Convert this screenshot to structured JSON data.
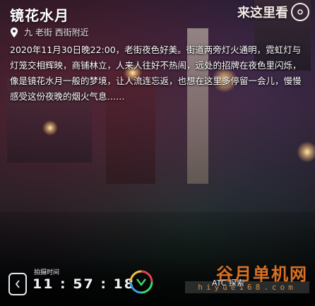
{
  "header": {
    "title": "镜花水月",
    "corner_text": "来这里看"
  },
  "location": {
    "icon": "location-pin-icon",
    "text": "九 老街 西街附近"
  },
  "description": "2020年11月30日晚22:00，老街夜色好美。街道两旁灯火通明，霓虹灯与灯笼交相辉映，商铺林立，人来人往好不热闹，远处的招牌在夜色里闪烁，像是镜花水月一般的梦境，让人流连忘返，也想在这里多停留一会儿，慢慢感受这份夜晚的烟火气息……",
  "footer": {
    "clock_icon": "clock-icon",
    "time_label": "拍摄时间",
    "time_value": "11 : 57 : 18",
    "logo_icon": "app-logo-icon",
    "credit": "ATC 探索",
    "watermark_main": "谷月单机网",
    "watermark_sub": "hiyue168.com"
  },
  "colors": {
    "accent_green": "#3fd46a",
    "accent_red": "#e2444b",
    "watermark": "#ff8228"
  }
}
